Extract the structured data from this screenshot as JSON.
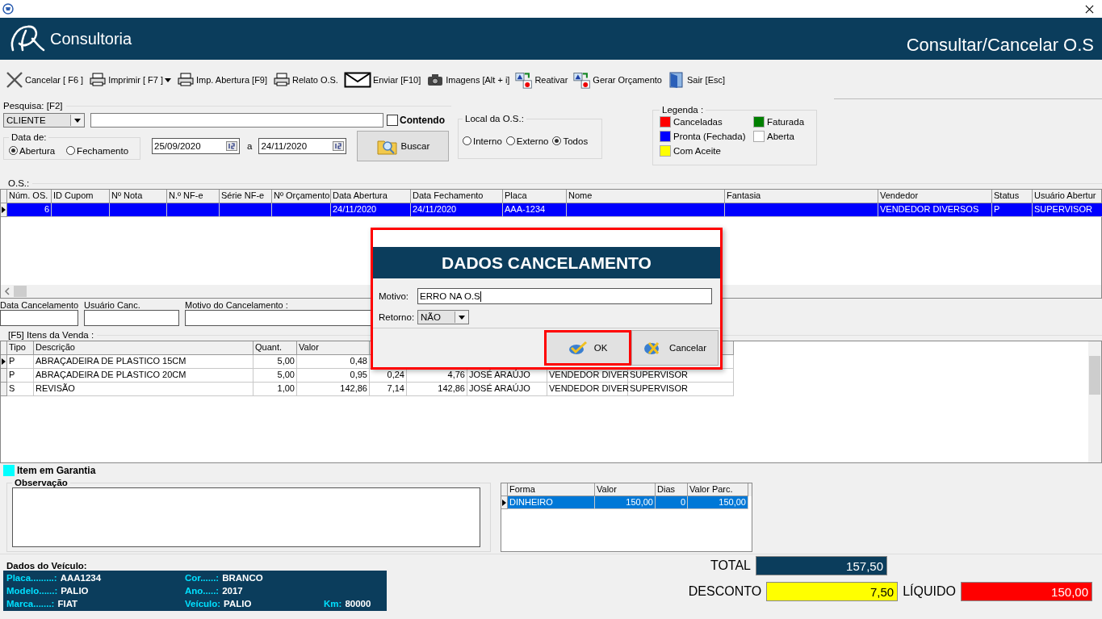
{
  "header": {
    "logo_text": "Consultoria",
    "title": "Consultar/Cancelar O.S"
  },
  "toolbar": [
    {
      "label": "Cancelar [ F6 ]",
      "kind": "cancel",
      "dropdown": false
    },
    {
      "label": "Imprimir  [ F7 ]",
      "kind": "print",
      "dropdown": true
    },
    {
      "label": "Imp. Abertura  [F9]",
      "kind": "print",
      "dropdown": false
    },
    {
      "label": "Relato O.S.",
      "kind": "print",
      "dropdown": false
    },
    {
      "label": "Enviar [F10]",
      "kind": "mail",
      "dropdown": false
    },
    {
      "label": "Imagens [Alt + i]",
      "kind": "camera",
      "dropdown": false
    },
    {
      "label": "Reativar",
      "kind": "swap",
      "dropdown": false
    },
    {
      "label": "Gerar Orçamento",
      "kind": "swap",
      "dropdown": false
    },
    {
      "label": "Sair [Esc]",
      "kind": "exit",
      "dropdown": false
    }
  ],
  "search": {
    "label": "Pesquisa: [F2]",
    "field": "CLIENTE",
    "contains": {
      "label": "Contendo",
      "checked": false
    },
    "date_group": {
      "label": "Data de:",
      "options": [
        {
          "label": "Abertura",
          "selected": true
        },
        {
          "label": "Fechamento",
          "selected": false
        }
      ]
    },
    "date_from": "25/09/2020",
    "date_sep": "a",
    "date_to": "24/11/2020",
    "search_button": "Buscar"
  },
  "location": {
    "label": "Local da O.S.:",
    "options": [
      {
        "label": "Interno",
        "selected": false
      },
      {
        "label": "Externo",
        "selected": false
      },
      {
        "label": "Todos",
        "selected": true
      }
    ]
  },
  "legend": {
    "label": "Legenda :",
    "items": [
      {
        "label": "Canceladas",
        "color": "#ff0000"
      },
      {
        "label": "Faturada",
        "color": "#008000"
      },
      {
        "label": "Pronta (Fechada)",
        "color": "#0000ff"
      },
      {
        "label": "Aberta",
        "color": "#ffffff"
      },
      {
        "label": "Com Aceite",
        "color": "#ffff00"
      }
    ]
  },
  "orders": {
    "label": "O.S.:",
    "columns": [
      "Núm. OS.",
      "ID Cupom",
      "Nº Nota",
      "N.º NF-e",
      "Série NF-e",
      "Nº Orçamento",
      "Data Abertura",
      "Data Fechamento",
      "Placa",
      "Nome",
      "Fantasia",
      "Vendedor",
      "Status",
      "Usuário Abertur"
    ],
    "rows": [
      {
        "selected": true,
        "cells": [
          "6",
          null,
          null,
          null,
          null,
          null,
          "24/11/2020",
          "24/11/2020",
          "AAA-1234",
          null,
          null,
          "VENDEDOR DIVERSOS",
          "P",
          "SUPERVISOR"
        ]
      }
    ]
  },
  "cancel_info": {
    "fields": [
      "Data Cancelamento",
      "Usuário Canc.",
      "Motivo do Cancelamento  :"
    ]
  },
  "items": {
    "label": "[F5]  Itens da Venda  :",
    "columns": [
      "Tipo",
      "Descrição",
      "Quant.",
      "Valor"
    ],
    "rows": [
      {
        "selected": true,
        "cells": [
          "P",
          "ABRAÇADEIRA DE PLASTICO 15CM",
          "5,00",
          "0,48"
        ]
      },
      {
        "selected": false,
        "cells": [
          "P",
          "ABRAÇADEIRA DE PLASTICO 20CM",
          "5,00",
          "0,95",
          "0,24",
          "4,76",
          "JOSÉ ARAÚJO",
          "VENDEDOR DIVER",
          "SUPERVISOR"
        ]
      },
      {
        "selected": false,
        "cells": [
          "S",
          "REVISÃO",
          "1,00",
          "142,86",
          "7,14",
          "142,86",
          "JOSÉ ARAÚJO",
          "VENDEDOR DIVER",
          "SUPERVISOR"
        ]
      }
    ]
  },
  "warranty": {
    "label": "Item em Garantia",
    "color": "#00ffff"
  },
  "observation": {
    "label": "Observação"
  },
  "payments": {
    "columns": [
      "Forma",
      "Valor",
      "Dias",
      "Valor Parc."
    ],
    "rows": [
      {
        "selected": true,
        "cells": [
          "DINHEIRO",
          "150,00",
          "0",
          "150,00"
        ]
      }
    ]
  },
  "vehicle": {
    "label": "Dados do Veículo:",
    "rows": [
      [
        {
          "label": "Placa.........:",
          "value": "AAA1234"
        },
        {
          "label": "Cor......:",
          "value": "BRANCO"
        }
      ],
      [
        {
          "label": "Modelo......:",
          "value": "PALIO"
        },
        {
          "label": "Ano.....:",
          "value": "2017"
        }
      ],
      [
        {
          "label": "Marca.......:",
          "value": "FIAT"
        },
        {
          "label": "Veículo:",
          "value": "PALIO"
        },
        {
          "label": "Km:",
          "value": "80000"
        }
      ]
    ]
  },
  "totals": [
    {
      "label": "TOTAL",
      "value": "157,50",
      "color": "#0b3d5c"
    },
    {
      "label": "DESCONTO",
      "value": "7,50",
      "color": "#ffff00"
    },
    {
      "label": "LÍQUIDO",
      "value": "150,00",
      "color": "#ff0000"
    }
  ],
  "dialog": {
    "title": "DADOS CANCELAMENTO",
    "highlighted": true,
    "fields": [
      {
        "label": "Motivo:",
        "value": "ERRO NA O.S",
        "kind": "text"
      },
      {
        "label": "Retorno:",
        "value": "NÃO",
        "kind": "select"
      }
    ],
    "buttons": [
      {
        "label": "OK",
        "kind": "ok",
        "highlighted": true
      },
      {
        "label": "Cancelar",
        "kind": "cancel",
        "highlighted": false
      }
    ]
  }
}
